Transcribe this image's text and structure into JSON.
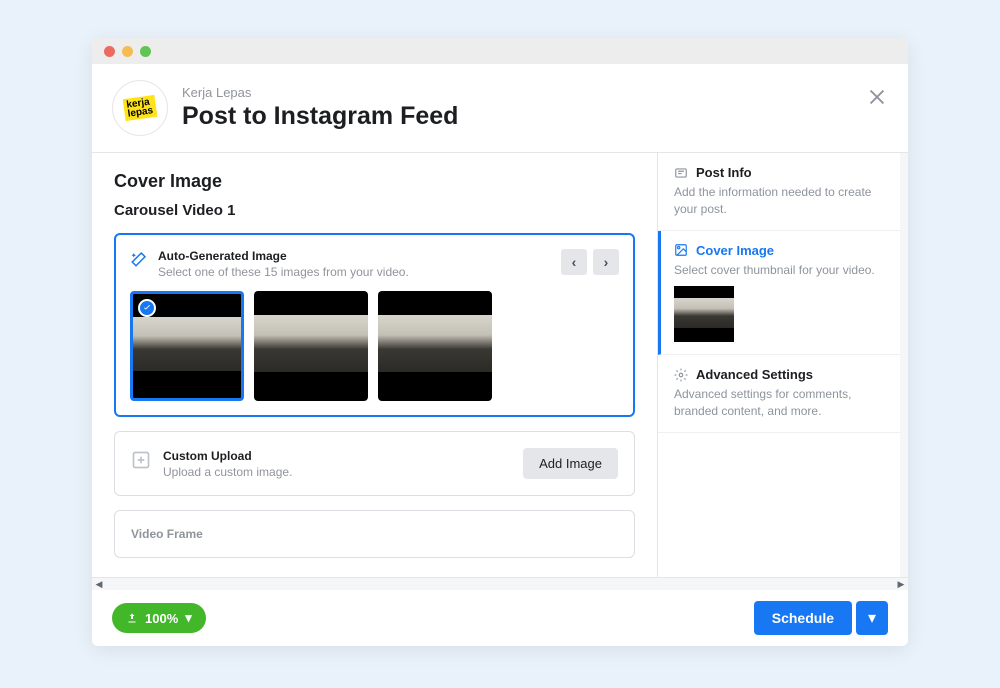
{
  "brand": {
    "name": "Kerja\nLepas"
  },
  "header": {
    "subtitle": "Kerja Lepas",
    "title": "Post to Instagram Feed"
  },
  "main": {
    "heading": "Cover Image",
    "subheading": "Carousel Video 1",
    "auto": {
      "title": "Auto-Generated Image",
      "desc": "Select one of these 15 images from your video."
    },
    "custom": {
      "title": "Custom Upload",
      "desc": "Upload a custom image.",
      "button": "Add Image"
    },
    "frame": {
      "title": "Video Frame"
    }
  },
  "sidebar": {
    "postinfo": {
      "title": "Post Info",
      "desc": "Add the information needed to create your post."
    },
    "cover": {
      "title": "Cover Image",
      "desc": "Select cover thumbnail for your video."
    },
    "advanced": {
      "title": "Advanced Settings",
      "desc": "Advanced settings for comments, branded content, and more."
    }
  },
  "footer": {
    "status": "100%",
    "schedule": "Schedule"
  }
}
